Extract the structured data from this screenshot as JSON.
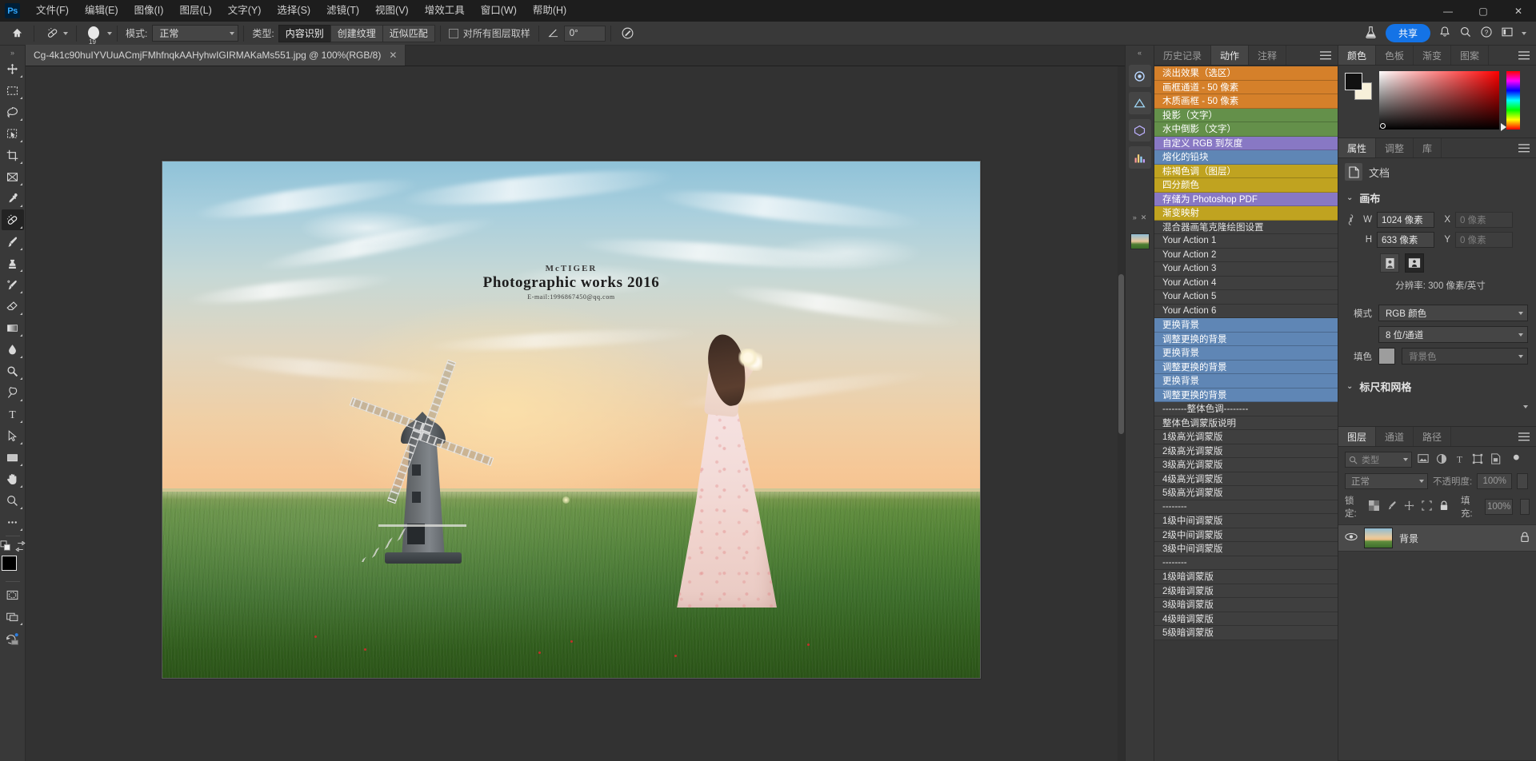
{
  "app": {
    "logo": "Ps"
  },
  "menubar": {
    "items": [
      {
        "label": "文件(F)",
        "name": "menu-file"
      },
      {
        "label": "编辑(E)",
        "name": "menu-edit"
      },
      {
        "label": "图像(I)",
        "name": "menu-image"
      },
      {
        "label": "图层(L)",
        "name": "menu-layer"
      },
      {
        "label": "文字(Y)",
        "name": "menu-type"
      },
      {
        "label": "选择(S)",
        "name": "menu-select"
      },
      {
        "label": "滤镜(T)",
        "name": "menu-filter"
      },
      {
        "label": "视图(V)",
        "name": "menu-view"
      },
      {
        "label": "增效工具",
        "name": "menu-plugins"
      },
      {
        "label": "窗口(W)",
        "name": "menu-window"
      },
      {
        "label": "帮助(H)",
        "name": "menu-help"
      }
    ],
    "window_controls": {
      "minimize": "—",
      "maximize": "▢",
      "close": "✕"
    }
  },
  "options_bar": {
    "mode_label": "模式:",
    "mode_value": "正常",
    "type_label": "类型:",
    "type_options": [
      "内容识别",
      "创建纹理",
      "近似匹配"
    ],
    "type_active": "内容识别",
    "sample_all_layers": "对所有图层取样",
    "brush_size": "19",
    "angle_value": "0°"
  },
  "topbar_right": {
    "share_label": "共享",
    "icons": [
      "flask-icon",
      "bell-icon",
      "search-icon",
      "help-icon",
      "workspace-icon",
      "chevron-down-icon"
    ]
  },
  "toolbar": {
    "tools": [
      {
        "name": "move-tool",
        "selected": false
      },
      {
        "name": "rectangular-marquee-tool",
        "selected": false
      },
      {
        "name": "lasso-tool",
        "selected": false
      },
      {
        "name": "object-selection-tool",
        "selected": false
      },
      {
        "name": "crop-tool",
        "selected": false
      },
      {
        "name": "frame-tool",
        "selected": false
      },
      {
        "name": "eyedropper-tool",
        "selected": false
      },
      {
        "name": "spot-healing-brush-tool",
        "selected": true
      },
      {
        "name": "brush-tool",
        "selected": false
      },
      {
        "name": "clone-stamp-tool",
        "selected": false
      },
      {
        "name": "history-brush-tool",
        "selected": false
      },
      {
        "name": "eraser-tool",
        "selected": false
      },
      {
        "name": "gradient-tool",
        "selected": false
      },
      {
        "name": "blur-tool",
        "selected": false
      },
      {
        "name": "dodge-tool",
        "selected": false
      },
      {
        "name": "pen-tool",
        "selected": false
      },
      {
        "name": "type-tool",
        "selected": false
      },
      {
        "name": "path-selection-tool",
        "selected": false
      },
      {
        "name": "rectangle-tool",
        "selected": false
      },
      {
        "name": "hand-tool",
        "selected": false
      },
      {
        "name": "zoom-tool",
        "selected": false
      },
      {
        "name": "edit-toolbar-tool",
        "selected": false
      }
    ],
    "foreground_color": "#000000",
    "background_color": "#f7f0da"
  },
  "document": {
    "tab_title": "Cg-4k1c90huIYVUuACmjFMhfnqkAAHyhwIGIRMAKaMs551.jpg @ 100%(RGB/8)",
    "close_glyph": "✕",
    "watermark": {
      "line1": "McTIGER",
      "line2": "Photographic works 2016",
      "line3": "E-mail:1996867450@qq.com"
    }
  },
  "actions_panel": {
    "tabs": [
      {
        "label": "历史记录",
        "name": "tab-history",
        "active": false
      },
      {
        "label": "动作",
        "name": "tab-actions",
        "active": true
      },
      {
        "label": "注释",
        "name": "tab-notes",
        "active": false
      }
    ],
    "items": [
      {
        "label": "淡出效果（选区）",
        "color": "#d5802a"
      },
      {
        "label": "画框通道 - 50 像素",
        "color": "#d5802a"
      },
      {
        "label": "木质画框 - 50 像素",
        "color": "#d5802a"
      },
      {
        "label": "投影（文字）",
        "color": "#64904a"
      },
      {
        "label": "水中倒影（文字）",
        "color": "#64904a"
      },
      {
        "label": "自定义 RGB 到灰度",
        "color": "#8878c4"
      },
      {
        "label": "熔化的铅块",
        "color": "#5f86b5"
      },
      {
        "label": "棕褐色调（图层）",
        "color": "#c0a320"
      },
      {
        "label": "四分颜色",
        "color": "#c0a320"
      },
      {
        "label": "存储为 Photoshop PDF",
        "color": "#8878c4"
      },
      {
        "label": "渐变映射",
        "color": "#c0a320"
      },
      {
        "label": "混合器画笔克隆绘图设置",
        "color": "#3f3f3f"
      },
      {
        "label": "Your Action 1",
        "color": "#3f3f3f"
      },
      {
        "label": "Your Action 2",
        "color": "#3f3f3f"
      },
      {
        "label": "Your Action 3",
        "color": "#3f3f3f"
      },
      {
        "label": "Your Action 4",
        "color": "#3f3f3f"
      },
      {
        "label": "Your Action 5",
        "color": "#3f3f3f"
      },
      {
        "label": "Your Action 6",
        "color": "#3f3f3f"
      },
      {
        "label": "更换背景",
        "color": "#5f86b5"
      },
      {
        "label": "调整更换的背景",
        "color": "#5f86b5"
      },
      {
        "label": "更换背景",
        "color": "#5f86b5"
      },
      {
        "label": "调整更换的背景",
        "color": "#5f86b5"
      },
      {
        "label": "更换背景",
        "color": "#5f86b5"
      },
      {
        "label": "调整更换的背景",
        "color": "#5f86b5"
      },
      {
        "label": "--------整体色调--------",
        "color": "#3f3f3f"
      },
      {
        "label": "整体色调蒙版说明",
        "color": "#3f3f3f"
      },
      {
        "label": "1级高光调蒙版",
        "color": "#3f3f3f"
      },
      {
        "label": "2级高光调蒙版",
        "color": "#3f3f3f"
      },
      {
        "label": "3级高光调蒙版",
        "color": "#3f3f3f"
      },
      {
        "label": "4级高光调蒙版",
        "color": "#3f3f3f"
      },
      {
        "label": "5级高光调蒙版",
        "color": "#3f3f3f"
      },
      {
        "label": "--------",
        "color": "#3f3f3f"
      },
      {
        "label": "1级中间调蒙版",
        "color": "#3f3f3f"
      },
      {
        "label": "2级中间调蒙版",
        "color": "#3f3f3f"
      },
      {
        "label": "3级中间调蒙版",
        "color": "#3f3f3f"
      },
      {
        "label": "--------",
        "color": "#3f3f3f"
      },
      {
        "label": "1级暗调蒙版",
        "color": "#3f3f3f"
      },
      {
        "label": "2级暗调蒙版",
        "color": "#3f3f3f"
      },
      {
        "label": "3级暗调蒙版",
        "color": "#3f3f3f"
      },
      {
        "label": "4级暗调蒙版",
        "color": "#3f3f3f"
      },
      {
        "label": "5级暗调蒙版",
        "color": "#3f3f3f"
      }
    ]
  },
  "color_panel": {
    "tabs": [
      {
        "label": "颜色",
        "active": true
      },
      {
        "label": "色板",
        "active": false
      },
      {
        "label": "渐变",
        "active": false
      },
      {
        "label": "图案",
        "active": false
      }
    ]
  },
  "properties_panel": {
    "tabs": [
      {
        "label": "属性",
        "active": true
      },
      {
        "label": "调整",
        "active": false
      },
      {
        "label": "库",
        "active": false
      }
    ],
    "doc_label": "文档",
    "canvas_section": "画布",
    "width_label": "W",
    "width_value": "1024 像素",
    "height_label": "H",
    "height_value": "633 像素",
    "x_label": "X",
    "x_value": "0 像素",
    "y_label": "Y",
    "y_value": "0 像素",
    "resolution": "分辨率: 300 像素/英寸",
    "mode_label": "模式",
    "mode_value": "RGB 颜色",
    "depth_value": "8 位/通道",
    "fill_label": "填色",
    "fill_value": "背景色",
    "rulers_section": "标尺和网格"
  },
  "layers_panel": {
    "tabs": [
      {
        "label": "图层",
        "active": true
      },
      {
        "label": "通道",
        "active": false
      },
      {
        "label": "路径",
        "active": false
      }
    ],
    "filter_placeholder": "类型",
    "blend_mode": "正常",
    "opacity_label": "不透明度:",
    "opacity_value": "100%",
    "lock_label": "锁定:",
    "fill_label": "填充:",
    "fill_value": "100%",
    "layers": [
      {
        "name": "背景",
        "locked": true,
        "visible": true
      }
    ]
  }
}
